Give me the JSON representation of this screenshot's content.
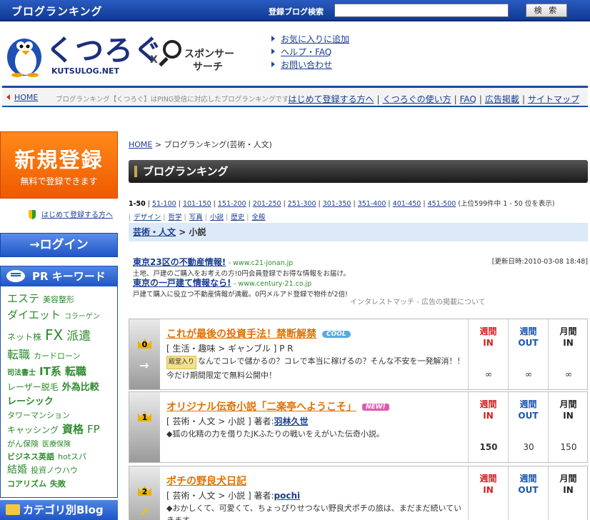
{
  "topbar": {
    "brand": "ブログランキング",
    "search_label": "登録ブログ検索",
    "search_value": "",
    "search_button": "検 索"
  },
  "header": {
    "logo_jp": "くつろぐ",
    "logo_en": "KUTSULOG.NET",
    "sponsor_x": "X",
    "sponsor_line1": "スポンサー",
    "sponsor_line2": "サーチ",
    "links": [
      "お気に入りに追加",
      "ヘルプ・FAQ",
      "お問い合わせ"
    ]
  },
  "navbar": {
    "home": "HOME",
    "description": "ブログランキング【くつろぐ】はPING受信に対応したブログランキングです。",
    "links": [
      "はじめて登録する方へ",
      "くつろぐの使い方",
      "FAQ",
      "広告掲載",
      "サイトマップ"
    ]
  },
  "sidebar": {
    "register_big": "新規登録",
    "register_small": "無料で登録できます",
    "beginner_link": "はじめて登録する方へ",
    "login": "ログイン",
    "pr_title": "PR キーワード",
    "keywords": [
      "エステ",
      "美容整形",
      "ダイエット",
      "コラーゲン",
      "ネット株",
      "FX",
      "派遣",
      "転職",
      "カードローン",
      "司法書士",
      "IT系",
      "転職",
      "レーザー脱毛",
      "外為比較",
      "レーシック",
      "タワーマンション",
      "キャッシング",
      "資格",
      "FP",
      "がん保険",
      "医療保険",
      "ビジネス英語",
      "hotスパ",
      "結婚",
      "投資ノウハウ",
      "コアリズム",
      "失敗"
    ],
    "category_title": "カテゴリ別Blog"
  },
  "main": {
    "breadcrumb_home": "HOME",
    "breadcrumb_sep": ">",
    "breadcrumb_current": "ブログランキング(芸術・人文)",
    "section_title": "ブログランキング",
    "pages": [
      "1-50",
      "51-100",
      "101-150",
      "151-200",
      "201-250",
      "251-300",
      "301-350",
      "351-400",
      "401-450",
      "451-500"
    ],
    "pages_note": "(上位599件中 1 - 50 位を表示)",
    "subcategories": [
      "デザイン",
      "哲学",
      "写真",
      "小説",
      "歴史",
      "全般"
    ],
    "category_parent": "芸術・人文",
    "category_sep": ">",
    "category_current": "小説",
    "updated": "[更新日時:2010-03-08 18:48]",
    "ads": [
      {
        "title": "東京23区の不動産情報!",
        "url": "- www.c21-jonan.jp",
        "desc": "土地、戸建のご購入をお考えの方!0円会員登録でお得な情報をお届け。"
      },
      {
        "title": "東京の一戸建て情報なら!",
        "url": "- www.century-21.co.jp",
        "desc": "戸建て購入に役立つ不動産情報が満載。0円メルアド登録で物件が2倍!"
      }
    ],
    "ads_note": "インタレストマッチ -  広告の掲載について",
    "stat_headers": {
      "in_top": "週間",
      "in_bottom": "IN",
      "out_top": "週間",
      "out_bottom": "OUT",
      "month_top": "月間",
      "month_bottom": "IN"
    },
    "entries": [
      {
        "rank": "0",
        "title": "これが最後の投資手法！禁断解禁",
        "badge": "COOL",
        "category": "[ 生活・趣味 > ギャンブル ] P R",
        "author_label": "",
        "author": "",
        "hall": "殿堂入り",
        "desc": "なんでコレで儲かるの？コレで本当に稼げるの？そんな不安を一発解消！！今だけ期間限定で無料公開中！",
        "arrow": "→",
        "in": "∞",
        "out": "∞",
        "month": "∞"
      },
      {
        "rank": "1",
        "title": "オリジナル伝奇小説「二楽亭へようこそ」",
        "badge": "NEW!",
        "category": "[ 芸術・人文 > 小説 ] 著者:",
        "author_label": "著者:",
        "author": "羽林久世",
        "hall": "",
        "desc": "◆狐の化精の力を借りたJKふたりの戦いをえがいた伝奇小説。",
        "arrow": "",
        "in": "150",
        "out": "30",
        "month": "150"
      },
      {
        "rank": "2",
        "title": "ポチの野良犬日記",
        "badge": "",
        "category": "[ 芸術・人文 > 小説 ] 著者:",
        "author_label": "著者:",
        "author": "pochi",
        "hall": "",
        "desc": "◆おかしくて、可愛くて、ちょっぴりせつない野良犬ポチの旅は、まだまだ続いていきます",
        "arrow": "↗",
        "in": "",
        "out": "",
        "month": ""
      }
    ]
  }
}
